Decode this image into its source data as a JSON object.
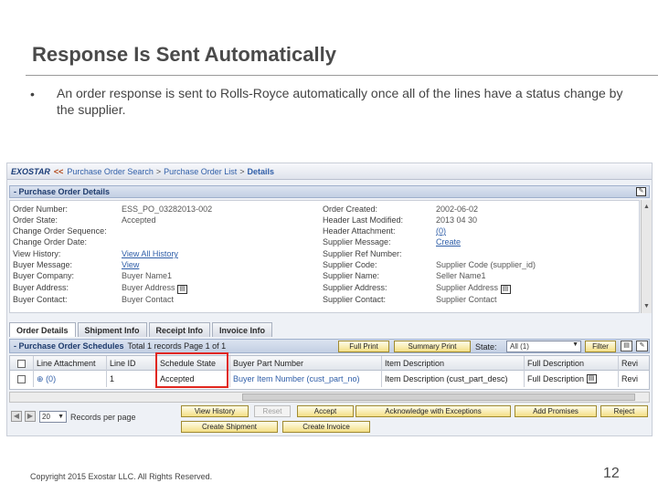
{
  "slide": {
    "title": "Response Is Sent Automatically",
    "bullet": "•",
    "bullet_text": "An order response is sent to Rolls-Royce automatically once all of the lines have a status change by the supplier.",
    "copyright": "Copyright 2015 Exostar LLC. All Rights Reserved.",
    "page_number": "12"
  },
  "breadcrumb": {
    "brand": "EXOSTAR",
    "separator": "<<",
    "items": [
      "Purchase Order Search",
      "Purchase Order List"
    ],
    "current": "Details",
    "gt": ">"
  },
  "details_panel": {
    "title": "- Purchase Order Details",
    "left_labels": [
      "Order Number:",
      "Order State:",
      "Change Order Sequence:",
      "Change Order Date:",
      "View History:",
      "Buyer Message:",
      "Buyer Company:",
      "Buyer Address:",
      "Buyer Contact:"
    ],
    "left_values": [
      "ESS_PO_03282013-002",
      "Accepted",
      "",
      "",
      "View All History",
      "View",
      "Buyer Name1",
      "Buyer Address",
      "Buyer Contact"
    ],
    "right_labels": [
      "Order Created:",
      "Header Last Modified:",
      "Header Attachment:",
      "Supplier Message:",
      "Supplier Ref Number:",
      "Supplier Code:",
      "Supplier Name:",
      "Supplier Address:",
      "Supplier Contact:"
    ],
    "right_values": [
      "2002-06-02",
      "2013 04 30",
      "(0)",
      "Create",
      "",
      "Supplier Code (supplier_id)",
      "Seller Name1",
      "Supplier Address",
      "Supplier Contact"
    ]
  },
  "tabs": [
    "Order Details",
    "Shipment Info",
    "Receipt Info",
    "Invoice Info"
  ],
  "schedules": {
    "title": "- Purchase Order Schedules",
    "info": "Total 1 records Page 1 of 1",
    "full_print": "Full Print",
    "summary_print": "Summary Print",
    "state_label": "State:",
    "state_value": "All (1)",
    "filter": "Filter"
  },
  "grid": {
    "headers": [
      "",
      "Line Attachment",
      "Line ID",
      "Schedule State",
      "Buyer Part Number",
      "Item Description",
      "Full Description",
      "Revi"
    ],
    "row": [
      "",
      "(0)",
      "1",
      "Accepted",
      "Buyer Item Number (cust_part_no)",
      "Item Description (cust_part_desc)",
      "Full Description",
      "Revi"
    ]
  },
  "actions": {
    "view_history": "View History",
    "reset": "Reset",
    "accept": "Accept",
    "ack_exceptions": "Acknowledge with Exceptions",
    "add_promises": "Add Promises",
    "reject": "Reject",
    "create_shipment": "Create Shipment",
    "create_invoice": "Create Invoice"
  },
  "pager": {
    "records_value": "20",
    "records_label": "Records per page"
  },
  "colors": {
    "highlight": "#e0261e",
    "link": "#2f5ea8",
    "panel_header": "#c3cfe3",
    "button": "#f4df86"
  }
}
